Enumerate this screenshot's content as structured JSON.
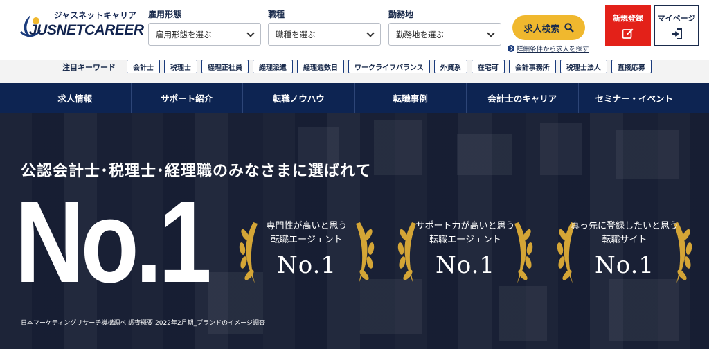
{
  "brand": {
    "kana": "ジャスネットキャリア",
    "name": "JUSNETCAREER"
  },
  "filters": [
    {
      "label": "雇用形態",
      "value": "雇用形態を選ぶ"
    },
    {
      "label": "職種",
      "value": "職種を選ぶ"
    },
    {
      "label": "勤務地",
      "value": "勤務地を選ぶ"
    }
  ],
  "search": {
    "button": "求人検索",
    "detail_link": "詳細条件から求人を探す"
  },
  "account": {
    "register": "新規登録",
    "mypage": "マイページ"
  },
  "keywords": {
    "title": "注目キーワード",
    "items": [
      "会計士",
      "税理士",
      "経理正社員",
      "経理派遣",
      "経理週数日",
      "ワークライフバランス",
      "外資系",
      "在宅可",
      "会計事務所",
      "税理士法人",
      "直接応募"
    ]
  },
  "nav": [
    "求人情報",
    "サポート紹介",
    "転職ノウハウ",
    "転職事例",
    "会計士のキャリア",
    "セミナー・イベント"
  ],
  "hero": {
    "subtitle": "公認会計士･税理士･経理職のみなさまに選ばれて",
    "headline": "No.1",
    "awards": [
      {
        "line1": "専門性が高いと思う",
        "line2": "転職エージェント",
        "rank": "No.1"
      },
      {
        "line1": "サポート力が高いと思う",
        "line2": "転職エージェント",
        "rank": "No.1"
      },
      {
        "line1": "真っ先に登録したいと思う",
        "line2": "転職サイト",
        "rank": "No.1"
      }
    ],
    "note": "日本マーケティングリサーチ機構調べ 調査概要 2022年2月期_ブランドのイメージ調査"
  },
  "colors": {
    "navy": "#0d2452",
    "accent_yellow": "#f0b82e",
    "register_red": "#e32119",
    "laurel_gold": "#d4a536"
  },
  "icons": {
    "search": "search-icon",
    "register": "edit-icon",
    "mypage": "login-icon",
    "laurel": "laurel-icon"
  }
}
